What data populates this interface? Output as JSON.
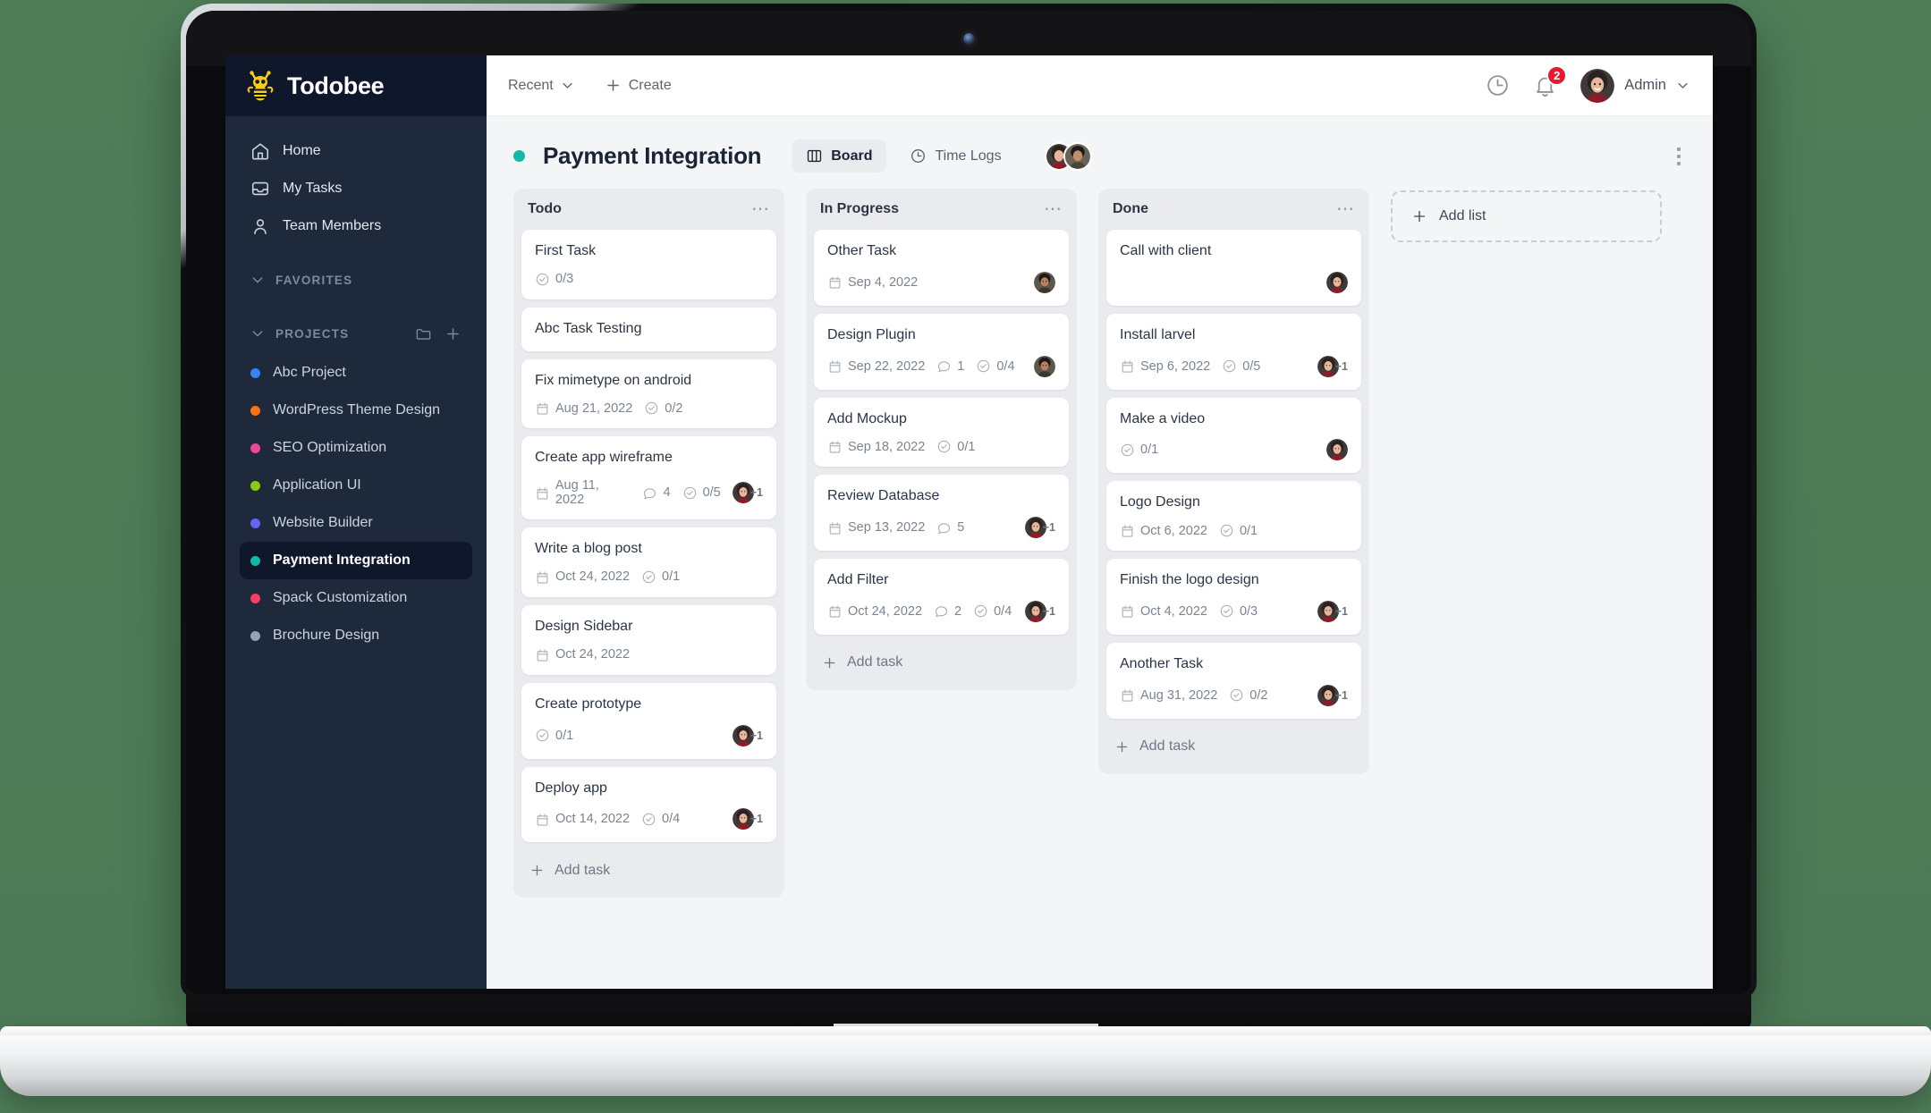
{
  "brand": {
    "name": "Todobee",
    "logo_icon": "bee-icon"
  },
  "sidebar": {
    "nav": [
      {
        "label": "Home",
        "icon": "home-icon"
      },
      {
        "label": "My Tasks",
        "icon": "inbox-icon"
      },
      {
        "label": "Team Members",
        "icon": "user-icon"
      }
    ],
    "favorites": {
      "label": "FAVORITES",
      "icon": "chevron-down-icon"
    },
    "projects_section": {
      "label": "PROJECTS",
      "icon": "chevron-down-icon",
      "folder_icon": "folder-icon",
      "add_icon": "plus-icon"
    },
    "projects": [
      {
        "label": "Abc Project",
        "color": "#3b82f6",
        "active": false
      },
      {
        "label": "WordPress Theme Design",
        "color": "#f97316",
        "active": false
      },
      {
        "label": "SEO Optimization",
        "color": "#ec4899",
        "active": false
      },
      {
        "label": "Application UI",
        "color": "#84cc16",
        "active": false
      },
      {
        "label": "Website Builder",
        "color": "#6366f1",
        "active": false
      },
      {
        "label": "Payment Integration",
        "color": "#14b8a6",
        "active": true
      },
      {
        "label": "Spack Customization",
        "color": "#f43f5e",
        "active": false
      },
      {
        "label": "Brochure Design",
        "color": "#94a3b8",
        "active": false
      }
    ]
  },
  "topbar": {
    "recent_label": "Recent",
    "recent_icon": "chevron-down-icon",
    "create_label": "Create",
    "create_icon": "plus-icon",
    "clock_icon": "clock-icon",
    "bell_icon": "bell-icon",
    "notification_count": "2",
    "user_name": "Admin",
    "user_chevron_icon": "chevron-down-icon",
    "user_avatar": "avatar-female"
  },
  "board_header": {
    "status_dot_color": "#14b8a6",
    "title": "Payment Integration",
    "tabs": [
      {
        "label": "Board",
        "icon": "board-icon",
        "active": true
      },
      {
        "label": "Time Logs",
        "icon": "clock-icon",
        "active": false
      }
    ],
    "members": [
      "avatar-female",
      "avatar-male"
    ],
    "menu_icon": "kebab-vertical-icon"
  },
  "add_list": {
    "label": "Add list",
    "icon": "plus-icon"
  },
  "add_task_label": "Add task",
  "columns": [
    {
      "title": "Todo",
      "menu_icon": "ellipsis-icon",
      "cards": [
        {
          "title": "First Task",
          "date": null,
          "comments": null,
          "checklist": "0/3",
          "avatar": null,
          "extra": null
        },
        {
          "title": "Abc Task Testing",
          "date": null,
          "comments": null,
          "checklist": null,
          "avatar": null,
          "extra": null
        },
        {
          "title": "Fix mimetype on android",
          "date": "Aug 21, 2022",
          "comments": null,
          "checklist": "0/2",
          "avatar": null,
          "extra": null
        },
        {
          "title": "Create app wireframe",
          "date": "Aug 11, 2022",
          "comments": "4",
          "checklist": "0/5",
          "avatar": "avatar-female",
          "extra": "+1"
        },
        {
          "title": "Write a blog post",
          "date": "Oct 24, 2022",
          "comments": null,
          "checklist": "0/1",
          "avatar": null,
          "extra": null
        },
        {
          "title": "Design Sidebar",
          "date": "Oct 24, 2022",
          "comments": null,
          "checklist": null,
          "avatar": null,
          "extra": null
        },
        {
          "title": "Create prototype",
          "date": null,
          "comments": null,
          "checklist": "0/1",
          "avatar": "avatar-female",
          "extra": "+1"
        },
        {
          "title": "Deploy app",
          "date": "Oct 14, 2022",
          "comments": null,
          "checklist": "0/4",
          "avatar": "avatar-female",
          "extra": "+1"
        }
      ]
    },
    {
      "title": "In Progress",
      "menu_icon": "ellipsis-icon",
      "cards": [
        {
          "title": "Other Task",
          "date": "Sep 4, 2022",
          "comments": null,
          "checklist": null,
          "avatar": "avatar-male",
          "extra": null
        },
        {
          "title": "Design Plugin",
          "date": "Sep 22, 2022",
          "comments": "1",
          "checklist": "0/4",
          "avatar": "avatar-male",
          "extra": null
        },
        {
          "title": "Add Mockup",
          "date": "Sep 18, 2022",
          "comments": null,
          "checklist": "0/1",
          "avatar": null,
          "extra": null
        },
        {
          "title": "Review Database",
          "date": "Sep 13, 2022",
          "comments": "5",
          "checklist": null,
          "avatar": "avatar-female",
          "extra": "+1"
        },
        {
          "title": "Add Filter",
          "date": "Oct 24, 2022",
          "comments": "2",
          "checklist": "0/4",
          "avatar": "avatar-female",
          "extra": "+1"
        }
      ]
    },
    {
      "title": "Done",
      "menu_icon": "ellipsis-icon",
      "cards": [
        {
          "title": "Call with client",
          "date": null,
          "comments": null,
          "checklist": null,
          "avatar": "avatar-female",
          "extra": null
        },
        {
          "title": "Install larvel",
          "date": "Sep 6, 2022",
          "comments": null,
          "checklist": "0/5",
          "avatar": "avatar-female",
          "extra": "+1"
        },
        {
          "title": "Make a video",
          "date": null,
          "comments": null,
          "checklist": "0/1",
          "avatar": "avatar-female",
          "extra": null
        },
        {
          "title": "Logo Design",
          "date": "Oct 6, 2022",
          "comments": null,
          "checklist": "0/1",
          "avatar": null,
          "extra": null
        },
        {
          "title": "Finish the logo design",
          "date": "Oct 4, 2022",
          "comments": null,
          "checklist": "0/3",
          "avatar": "avatar-female",
          "extra": "+1"
        },
        {
          "title": "Another Task",
          "date": "Aug 31, 2022",
          "comments": null,
          "checklist": "0/2",
          "avatar": "avatar-female",
          "extra": "+1"
        }
      ]
    }
  ]
}
